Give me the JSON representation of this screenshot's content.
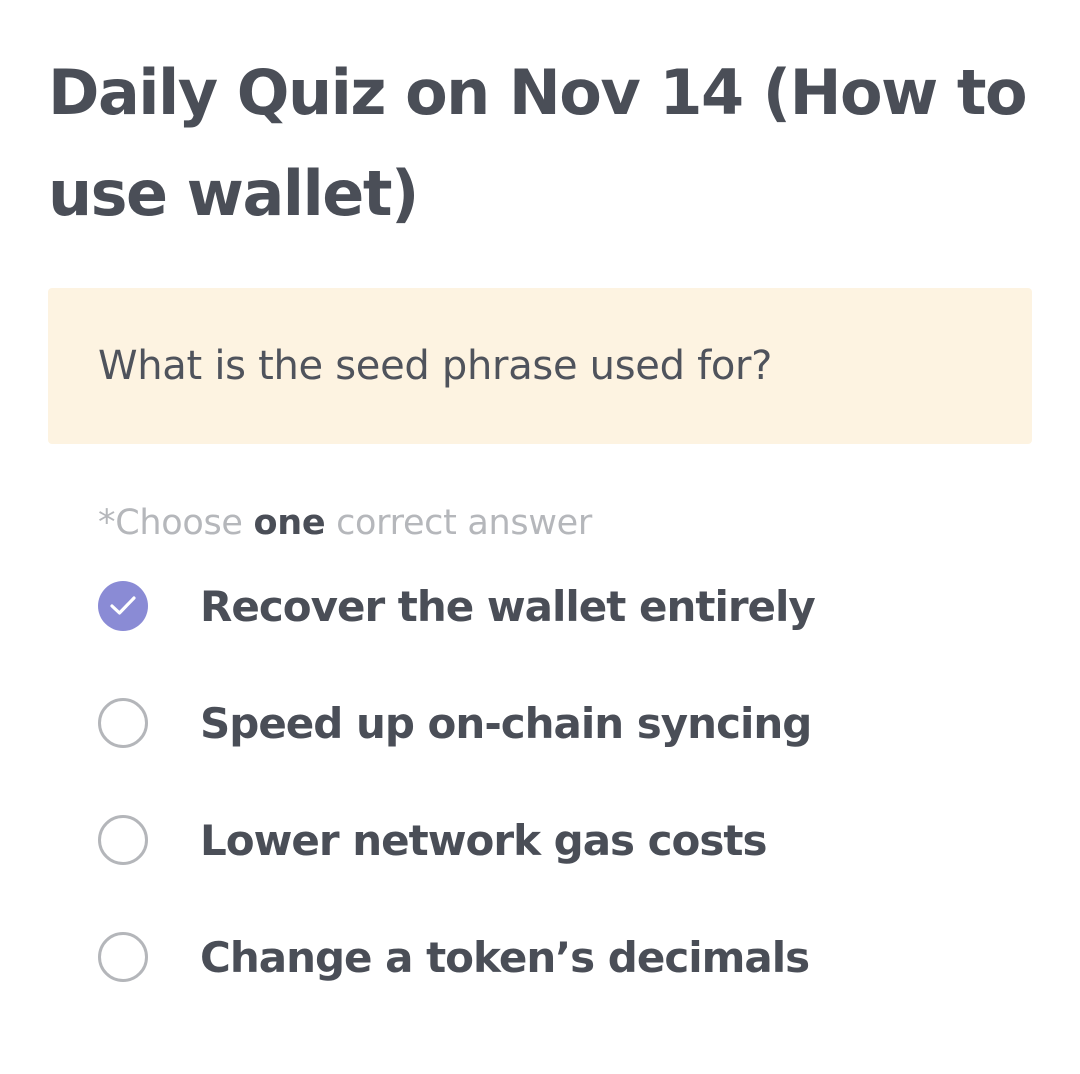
{
  "quiz": {
    "title": "Daily Quiz on Nov 14 (How to use wallet)",
    "question": "What is the seed phrase used for?",
    "instruction": {
      "prefix": "*Choose ",
      "emphasis": "one",
      "suffix": " correct answer"
    },
    "options": [
      {
        "label": "Recover the wallet entirely",
        "selected": true
      },
      {
        "label": "Speed up on-chain syncing",
        "selected": false
      },
      {
        "label": "Lower network gas costs",
        "selected": false
      },
      {
        "label": "Change a token’s decimals",
        "selected": false
      }
    ]
  },
  "colors": {
    "title": "#4a4e57",
    "question_background": "#fdf3e1",
    "instruction_muted": "#b5b7bb",
    "radio_selected": "#8a8bd5",
    "radio_border": "#b4b6ba"
  },
  "icons": {
    "selected_option": "checkmark-icon"
  }
}
